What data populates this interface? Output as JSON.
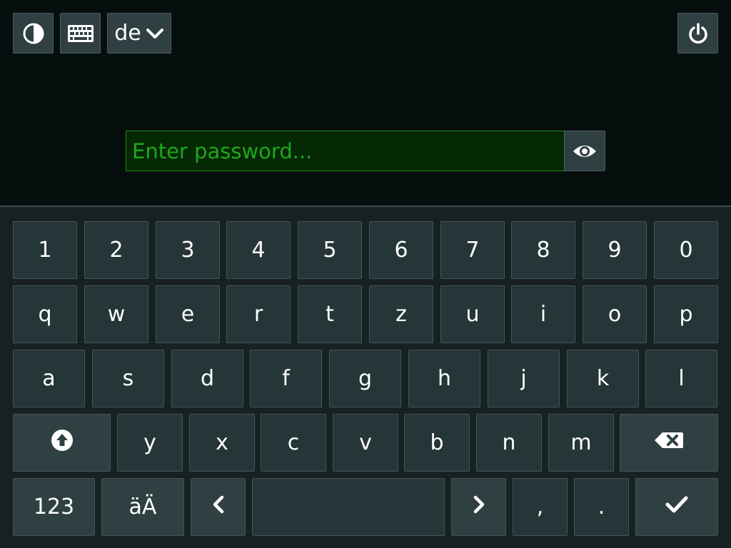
{
  "topbar": {
    "contrast_icon": "contrast-icon",
    "keyboard_icon": "keyboard-icon",
    "language": "de",
    "power_icon": "power-icon"
  },
  "password": {
    "placeholder": "Enter password...",
    "value": "",
    "reveal_icon": "eye-icon"
  },
  "colors": {
    "background": "#070e0e",
    "keyboard_bg": "#172124",
    "key_bg": "#253538",
    "field_bg": "#052904",
    "field_text": "#1ea81a"
  },
  "keyboard": {
    "row1": [
      "1",
      "2",
      "3",
      "4",
      "5",
      "6",
      "7",
      "8",
      "9",
      "0"
    ],
    "row2": [
      "q",
      "w",
      "e",
      "r",
      "t",
      "z",
      "u",
      "i",
      "o",
      "p"
    ],
    "row3": [
      "a",
      "s",
      "d",
      "f",
      "g",
      "h",
      "j",
      "k",
      "l"
    ],
    "row4": [
      "y",
      "x",
      "c",
      "v",
      "b",
      "n",
      "m"
    ],
    "shift_icon": "shift-icon",
    "backspace_icon": "backspace-icon",
    "numbers_label": "123",
    "umlaut_label": "äÄ",
    "left_icon": "chevron-left-icon",
    "space_label": "",
    "right_icon": "chevron-right-icon",
    "comma_label": ",",
    "period_label": ".",
    "enter_icon": "checkmark-icon"
  }
}
